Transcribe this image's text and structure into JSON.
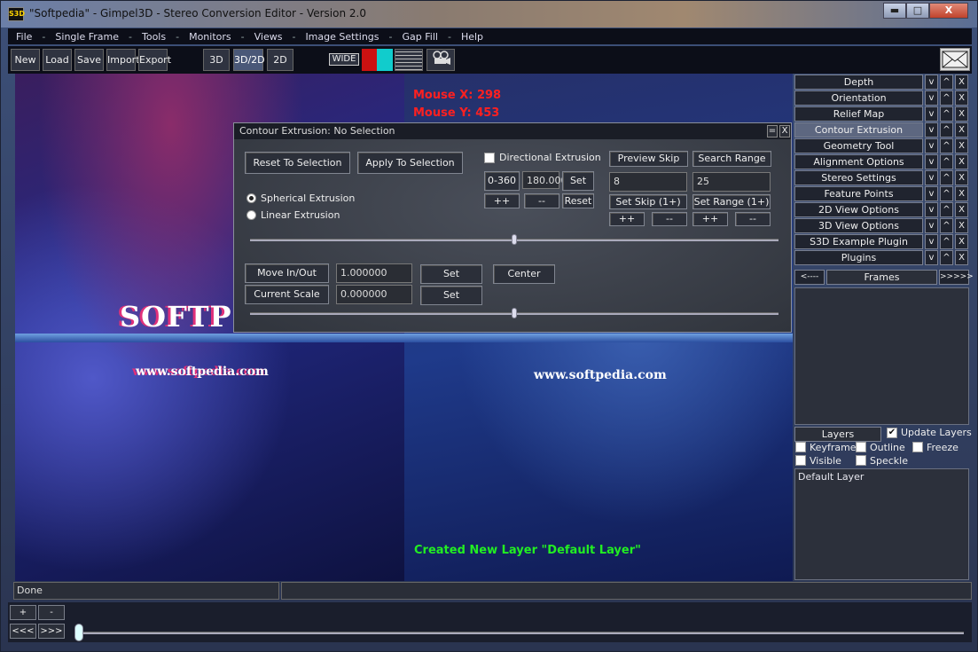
{
  "window": {
    "title": "\"Softpedia\" - Gimpel3D - Stereo Conversion Editor - Version 2.0",
    "app_icon_text": "S3D",
    "minimize": "▬",
    "maximize": "□",
    "close": "X"
  },
  "menu": [
    "File",
    "Single Frame",
    "Tools",
    "Monitors",
    "Views",
    "Image Settings",
    "Gap Fill",
    "Help"
  ],
  "menu_separator": "-",
  "toolbar": {
    "new": "New",
    "load": "Load",
    "save": "Save",
    "import": "Import",
    "export": "Export",
    "mode_3d": "3D",
    "mode_3d2d": "3D/2D",
    "mode_2d": "2D",
    "wide": "WIDE",
    "swatch_red": "#cc1111",
    "swatch_cyan": "#11cccc"
  },
  "canvas": {
    "mouse_x": "Mouse X: 298",
    "mouse_y": "Mouse Y: 453",
    "logo_text": "SOFTP",
    "url_left": "www.softpedia.com",
    "url_right": "www.softpedia.com",
    "message": "Created New Layer \"Default Layer\""
  },
  "dialog": {
    "title": "Contour Extrusion: No Selection",
    "min_btn": "=",
    "close_btn": "X",
    "reset_to_selection": "Reset To Selection",
    "apply_to_selection": "Apply To Selection",
    "directional_extrusion": "Directional Extrusion",
    "range_btn": "0-360",
    "angle_value": "180.000",
    "set": "Set",
    "reset": "Reset",
    "plusplus": "++",
    "minusminus": "--",
    "spherical_extrusion": "Spherical Extrusion",
    "linear_extrusion": "Linear Extrusion",
    "preview_skip": "Preview Skip",
    "search_range": "Search Range",
    "skip_value": "8",
    "range_value": "25",
    "set_skip": "Set Skip (1+)",
    "set_range": "Set Range (1+)",
    "move_in_out": "Move In/Out",
    "move_value": "1.000000",
    "current_scale": "Current Scale",
    "scale_value": "0.000000",
    "center": "Center",
    "slider1_pos": 0.5,
    "slider2_pos": 0.5
  },
  "side_panel": {
    "items": [
      "Depth",
      "Orientation",
      "Relief Map",
      "Contour Extrusion",
      "Geometry Tool",
      "Alignment Options",
      "Stereo Settings",
      "Feature Points",
      "2D View Options",
      "3D View Options",
      "S3D Example Plugin",
      "Plugins"
    ],
    "active": "Contour Extrusion",
    "btn_down": "v",
    "btn_up": "^",
    "btn_close": "X",
    "frames_prev": "<----",
    "frames_label": "Frames",
    "frames_next": ">>>>>",
    "layers_label": "Layers",
    "update_layers": "Update Layers",
    "keyframe": "Keyframe",
    "outline": "Outline",
    "freeze": "Freeze",
    "visible": "Visible",
    "speckle": "Speckle",
    "default_layer": "Default Layer"
  },
  "status": {
    "text": "Done"
  },
  "bottom": {
    "plus": "+",
    "minus": "-",
    "prev": "<<<",
    "next": ">>>"
  }
}
